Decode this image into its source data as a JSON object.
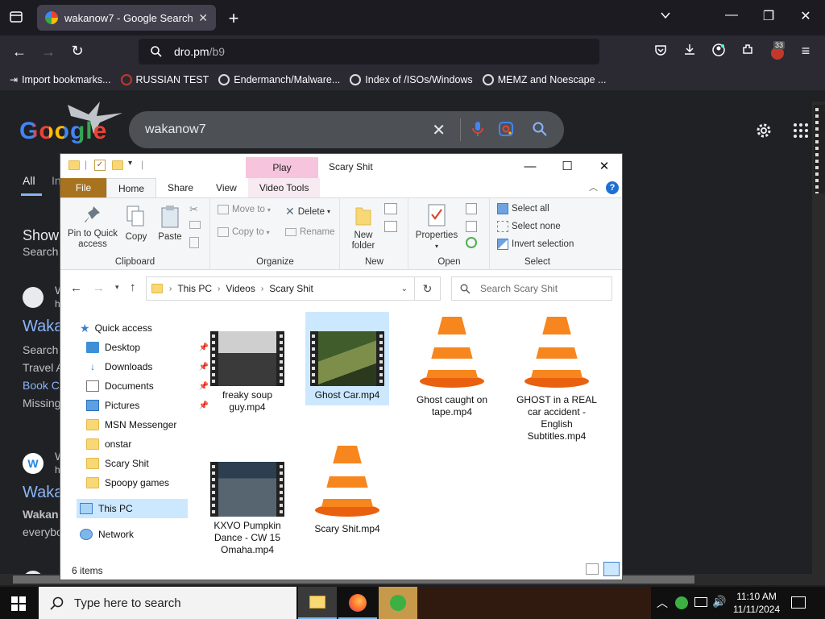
{
  "browser": {
    "tab_title": "wakanow7 - Google Search",
    "url_host": "dro.pm",
    "url_path": "/b9",
    "notif_count": "33",
    "bookmarks": [
      {
        "label": "Import bookmarks..."
      },
      {
        "label": "RUSSIAN TEST"
      },
      {
        "label": "Endermanch/Malware..."
      },
      {
        "label": "Index of /ISOs/Windows"
      },
      {
        "label": "MEMZ and Noescape ..."
      }
    ]
  },
  "google": {
    "logo": "Google",
    "query": "wakanow7",
    "tab_all": "All",
    "tab_partial": "In",
    "show_partial": "Show",
    "search_partial": "Search",
    "result1_partial": "W",
    "result1_sub": "h",
    "link1_partial": "Waka",
    "snip1": "Search",
    "snip2": "Travel A",
    "snip3": "Book C",
    "snip4": "Missing",
    "result2_partial": "W",
    "result2_sub": "h",
    "link2_partial": "Waka",
    "snip5": "Wakan",
    "snip6": "everybo"
  },
  "explorer": {
    "title": "Scary Shit",
    "play_tab": "Play",
    "ribbon_tabs": [
      "File",
      "Home",
      "Share",
      "View",
      "Video Tools"
    ],
    "clipboard": {
      "pin": "Pin to Quick access",
      "copy": "Copy",
      "paste": "Paste",
      "group": "Clipboard"
    },
    "organize": {
      "move_to": "Move to",
      "copy_to": "Copy to",
      "delete": "Delete",
      "rename": "Rename",
      "group": "Organize"
    },
    "new": {
      "new_folder": "New folder",
      "group": "New"
    },
    "open": {
      "properties": "Properties",
      "group": "Open"
    },
    "select": {
      "select_all": "Select all",
      "select_none": "Select none",
      "invert": "Invert selection",
      "group": "Select"
    },
    "breadcrumb": [
      "This PC",
      "Videos",
      "Scary Shit"
    ],
    "search_placeholder": "Search Scary Shit",
    "nav": {
      "quick_access": "Quick access",
      "items": [
        "Desktop",
        "Downloads",
        "Documents",
        "Pictures",
        "MSN Messenger",
        "onstar",
        "Scary Shit",
        "Spoopy games"
      ],
      "this_pc": "This PC",
      "network": "Network"
    },
    "files": [
      {
        "name": "freaky soup guy.mp4",
        "kind": "video"
      },
      {
        "name": "Ghost Car.mp4",
        "kind": "video",
        "selected": true
      },
      {
        "name": "Ghost caught on tape.mp4",
        "kind": "vlc"
      },
      {
        "name": "GHOST in a REAL car accident - English Subtitles.mp4",
        "kind": "vlc"
      },
      {
        "name": "KXVO Pumpkin Dance - CW 15 Omaha.mp4",
        "kind": "video"
      },
      {
        "name": "Scary Shit.mp4",
        "kind": "vlc"
      }
    ],
    "status": "6 items"
  },
  "taskbar": {
    "search_placeholder": "Type here to search",
    "time": "11:10 AM",
    "date": "11/11/2024"
  }
}
